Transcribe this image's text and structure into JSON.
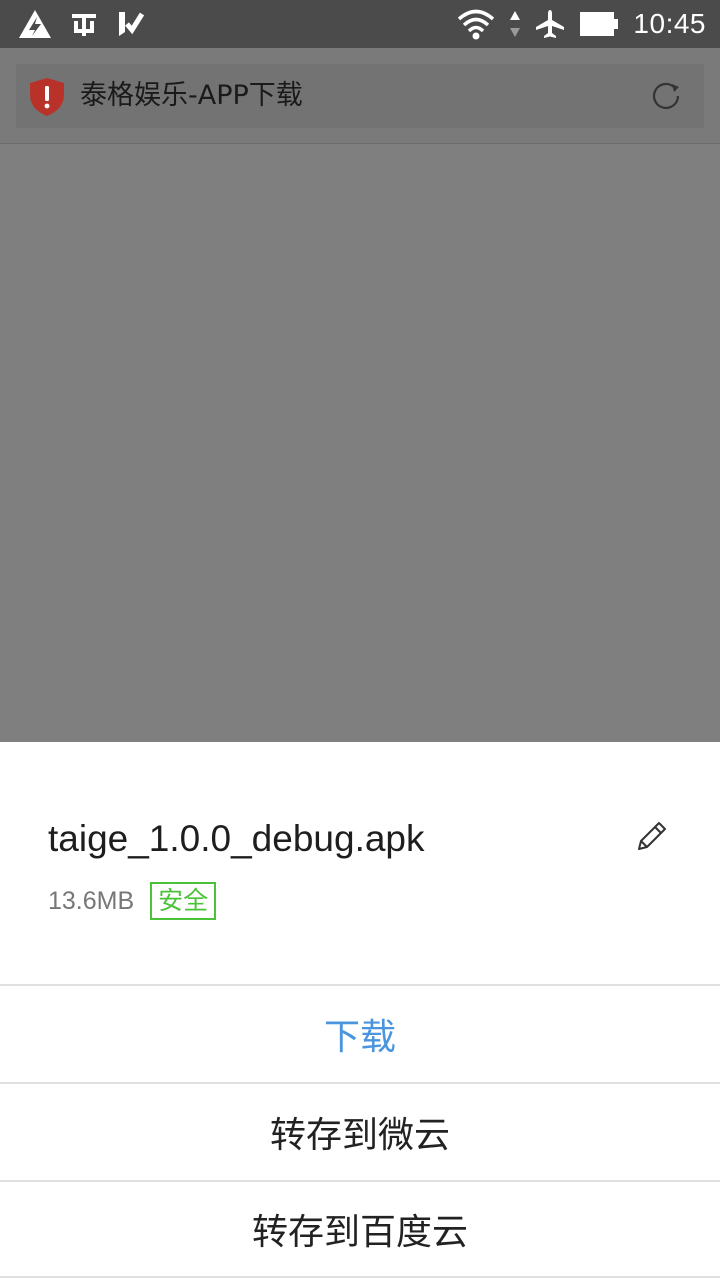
{
  "status_bar": {
    "time": "10:45",
    "icons": [
      "warning-triangle-icon",
      "app-notification-icon",
      "vpn-check-icon",
      "wifi-icon",
      "data-arrows-icon",
      "airplane-icon",
      "battery-icon"
    ]
  },
  "address_bar": {
    "title": "泰格娱乐-APP下载",
    "security_icon": "danger-shield-icon",
    "refresh_icon": "refresh-icon",
    "security_color": "#c0392b"
  },
  "download_sheet": {
    "file_name": "taige_1.0.0_debug.apk",
    "file_size": "13.6MB",
    "safety_badge": "安全",
    "edit_icon": "pencil-icon",
    "actions": [
      {
        "label": "下载"
      },
      {
        "label": "转存到微云"
      },
      {
        "label": "转存到百度云"
      }
    ],
    "accent_color": "#4a95dd",
    "safe_color": "#4cc23a"
  }
}
